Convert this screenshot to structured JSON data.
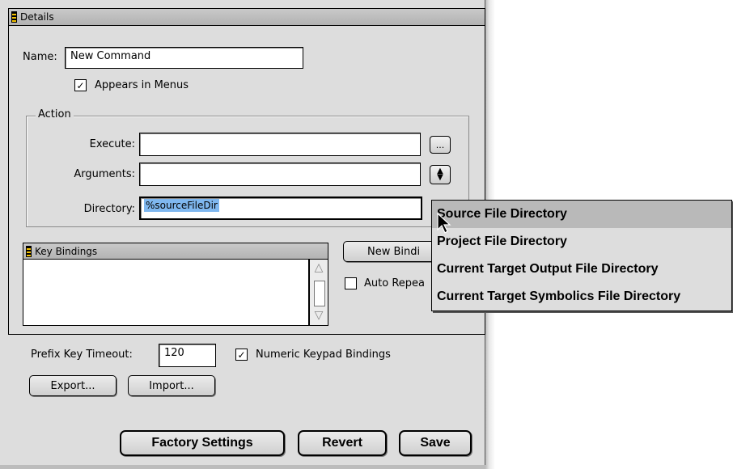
{
  "panel": {
    "title": "Details"
  },
  "name": {
    "label": "Name:",
    "value": "New Command"
  },
  "appears_in_menus": {
    "label": "Appears in Menus",
    "checked": true
  },
  "action": {
    "legend": "Action",
    "execute": {
      "label": "Execute:",
      "value": "",
      "button_label": "..."
    },
    "arguments": {
      "label": "Arguments:",
      "value": "",
      "button_icon": "up-down-arrows-icon"
    },
    "directory": {
      "label": "Directory:",
      "value": "%sourceFileDir"
    }
  },
  "key_bindings": {
    "title": "Key Bindings",
    "new_binding_label": "New Bindi",
    "auto_repeat_label": "Auto Repea",
    "auto_repeat_checked": false
  },
  "prefix_timeout": {
    "label": "Prefix Key Timeout:",
    "value": "120"
  },
  "numeric_keypad": {
    "label": "Numeric Keypad Bindings",
    "checked": true
  },
  "buttons": {
    "export": "Export...",
    "import": "Import...",
    "factory": "Factory Settings",
    "revert": "Revert",
    "save": "Save"
  },
  "popup_menu": {
    "items": [
      "Source File Directory",
      "Project File Directory",
      "Current Target Output File Directory",
      "Current Target Symbolics File Directory"
    ],
    "highlighted_index": 0
  },
  "colors": {
    "selection": "#7fb7ef",
    "window_bg": "#dddddd"
  }
}
